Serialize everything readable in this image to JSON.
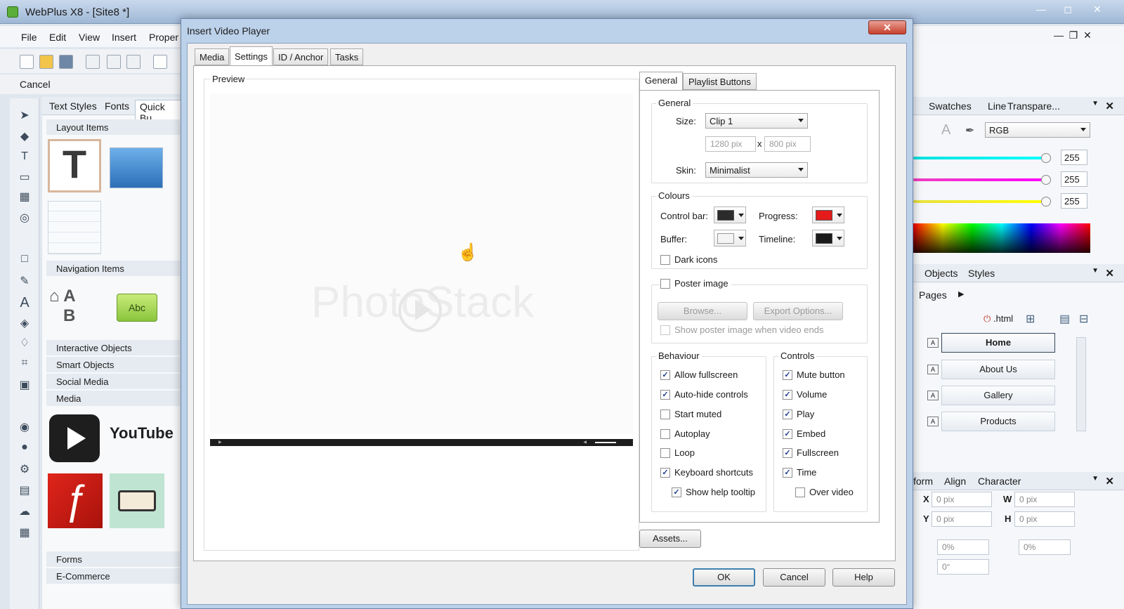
{
  "app": {
    "title": "WebPlus X8 - [Site8 *]",
    "window_controls": {
      "minimize": "—",
      "maximize": "◻",
      "close": "✕"
    },
    "menus": [
      "File",
      "Edit",
      "View",
      "Insert",
      "Proper"
    ],
    "cancel_label": "Cancel"
  },
  "gallery": {
    "tabs": [
      "Text Styles",
      "Fonts",
      "Quick Bu"
    ],
    "categories": {
      "layout": "Layout Items",
      "navigation": "Navigation Items",
      "interactive": "Interactive Objects",
      "smart": "Smart Objects",
      "social": "Social Media",
      "media": "Media",
      "forms": "Forms",
      "ecommerce": "E-Commerce"
    },
    "nav_thumb_text": "Abc",
    "youtube_text": "YouTube"
  },
  "right_panel": {
    "swatch_tabs": [
      "Swatches",
      "Line",
      "Transpare..."
    ],
    "color_mode": "RGB",
    "slider_values": [
      "255",
      "255",
      "255"
    ],
    "objects_tabs": [
      "Objects",
      "Styles"
    ],
    "pages_label": "Pages",
    "html_label": ".html",
    "pages": [
      "Home",
      "About Us",
      "Gallery",
      "Products"
    ],
    "transform_tabs": [
      "form",
      "Align",
      "Character"
    ],
    "transform": {
      "x_label": "X",
      "x_value": "0 pix",
      "y_label": "Y",
      "y_value": "0 pix",
      "w_label": "W",
      "w_value": "0 pix",
      "h_label": "H",
      "h_value": "0 pix",
      "scale_value": "0%",
      "scale2_value": "0%",
      "rotate_value": "0°"
    }
  },
  "dialog": {
    "title": "Insert Video Player",
    "close_glyph": "✕",
    "tabs": [
      "Media",
      "Settings",
      "ID / Anchor",
      "Tasks"
    ],
    "preview_label": "Preview",
    "watermark": "PhotoStack",
    "settings_tabs": [
      "General",
      "Playlist Buttons"
    ],
    "general": {
      "group_label": "General",
      "size_label": "Size:",
      "size_value": "Clip 1",
      "width_value": "1280 pix",
      "times": "x",
      "height_value": "800 pix",
      "skin_label": "Skin:",
      "skin_value": "Minimalist"
    },
    "colours": {
      "group_label": "Colours",
      "control_bar_label": "Control bar:",
      "progress_label": "Progress:",
      "buffer_label": "Buffer:",
      "timeline_label": "Timeline:",
      "dark_icons_label": "Dark icons",
      "swatch_colors": {
        "control_bar": "#2b2b2b",
        "progress": "#e51b1b",
        "buffer": "#f4f4f4",
        "timeline": "#1a1a1a"
      }
    },
    "poster": {
      "label": "Poster image",
      "browse_label": "Browse...",
      "export_label": "Export Options...",
      "show_when_ends_label": "Show poster image when video ends"
    },
    "behaviour": {
      "group_label": "Behaviour",
      "items": [
        {
          "label": "Allow fullscreen",
          "checked": true
        },
        {
          "label": "Auto-hide controls",
          "checked": true
        },
        {
          "label": "Start muted",
          "checked": false
        },
        {
          "label": "Autoplay",
          "checked": false
        },
        {
          "label": "Loop",
          "checked": false
        },
        {
          "label": "Keyboard shortcuts",
          "checked": true
        }
      ],
      "help_tooltip": {
        "label": "Show help tooltip",
        "checked": true
      }
    },
    "controls": {
      "group_label": "Controls",
      "items": [
        {
          "label": "Mute button",
          "checked": true
        },
        {
          "label": "Volume",
          "checked": true
        },
        {
          "label": "Play",
          "checked": true
        },
        {
          "label": "Embed",
          "checked": true
        },
        {
          "label": "Fullscreen",
          "checked": true
        },
        {
          "label": "Time",
          "checked": true
        }
      ],
      "over_video": {
        "label": "Over video",
        "checked": false
      }
    },
    "assets_label": "Assets...",
    "ok_label": "OK",
    "cancel_label": "Cancel",
    "help_label": "Help"
  }
}
